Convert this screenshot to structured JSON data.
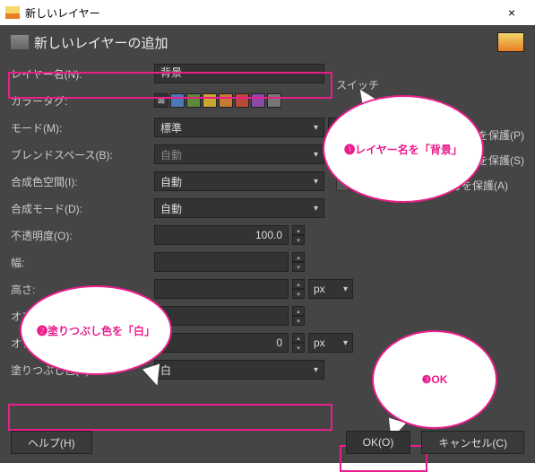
{
  "window": {
    "title": "新しいレイヤー",
    "close": "×"
  },
  "header": {
    "title": "新しいレイヤーの追加"
  },
  "labels": {
    "layer_name": "レイヤー名(N):",
    "color_tag": "カラータグ:",
    "mode": "モード(M):",
    "blend_space": "ブレンドスペース(B):",
    "composite_space": "合成色空間(I):",
    "composite_mode": "合成モード(D):",
    "opacity": "不透明度(O):",
    "width": "幅:",
    "height": "高さ:",
    "offset_x": "オフセット X:",
    "offset_y": "オフセット Y:",
    "fill": "塗りつぶし色(F):"
  },
  "values": {
    "layer_name": "背景",
    "mode": "標準",
    "blend_space": "自動",
    "composite_space": "自動",
    "composite_mode": "自動",
    "opacity": "100.0",
    "offset_y": "0",
    "fill": "白",
    "unit_px": "px"
  },
  "right": {
    "switch": "スイッチ",
    "lock_pixels": "を保護(P)",
    "lock_position": "を保護(S)",
    "lock_alpha": "透明部分を保護(A)"
  },
  "buttons": {
    "help": "ヘルプ(H)",
    "ok": "OK(O)",
    "cancel": "キャンセル(C)"
  },
  "callouts": {
    "c1": "❶レイヤー名を「背景」",
    "c2": "❷塗りつぶし色を「白」",
    "c3": "❸OK"
  },
  "colors": {
    "accent": "#e91e8c",
    "tags": [
      "#4a7ab8",
      "#5a8a3a",
      "#c9a832",
      "#c97a32",
      "#b84a3a",
      "#8a4aa8",
      "#777777"
    ]
  }
}
